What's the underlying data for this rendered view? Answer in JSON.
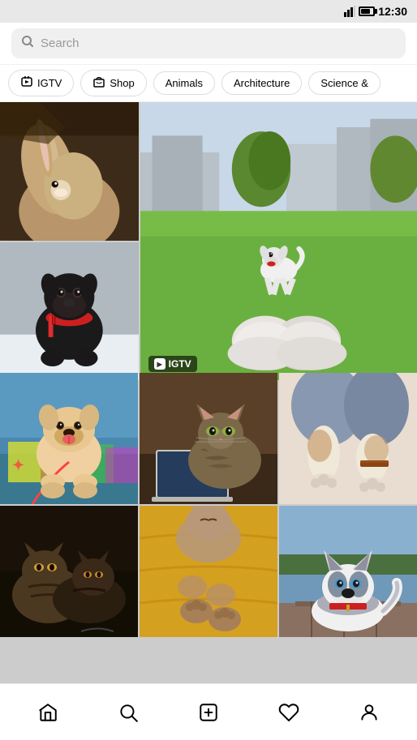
{
  "statusBar": {
    "time": "12:30"
  },
  "searchBar": {
    "placeholder": "Search"
  },
  "filters": [
    {
      "id": "igtv",
      "label": "IGTV",
      "icon": "📺"
    },
    {
      "id": "shop",
      "label": "Shop",
      "icon": "🛍"
    },
    {
      "id": "animals",
      "label": "Animals",
      "icon": ""
    },
    {
      "id": "architecture",
      "label": "Architecture",
      "icon": ""
    },
    {
      "id": "science",
      "label": "Science &",
      "icon": ""
    }
  ],
  "grid": {
    "cells": [
      {
        "id": "rabbit",
        "alt": "White rabbit close-up"
      },
      {
        "id": "dog-park",
        "alt": "Small white dog running in park",
        "badge": "IGTV"
      },
      {
        "id": "dog-scarf",
        "alt": "Black dog wearing red scarf"
      },
      {
        "id": "pitbull",
        "alt": "Pit bull with leash in colorful area"
      },
      {
        "id": "cat-laptop",
        "alt": "Tabby cat next to laptop"
      },
      {
        "id": "dog-feet",
        "alt": "Dog paws and human feet"
      },
      {
        "id": "cats-cuddle",
        "alt": "Two cats cuddling"
      },
      {
        "id": "cat-blanket",
        "alt": "Cats on golden blanket"
      },
      {
        "id": "husky",
        "alt": "Husky by lake"
      }
    ]
  },
  "bottomNav": {
    "items": [
      {
        "id": "home",
        "label": "Home"
      },
      {
        "id": "search",
        "label": "Search"
      },
      {
        "id": "add",
        "label": "Add"
      },
      {
        "id": "heart",
        "label": "Activity"
      },
      {
        "id": "profile",
        "label": "Profile"
      }
    ]
  }
}
